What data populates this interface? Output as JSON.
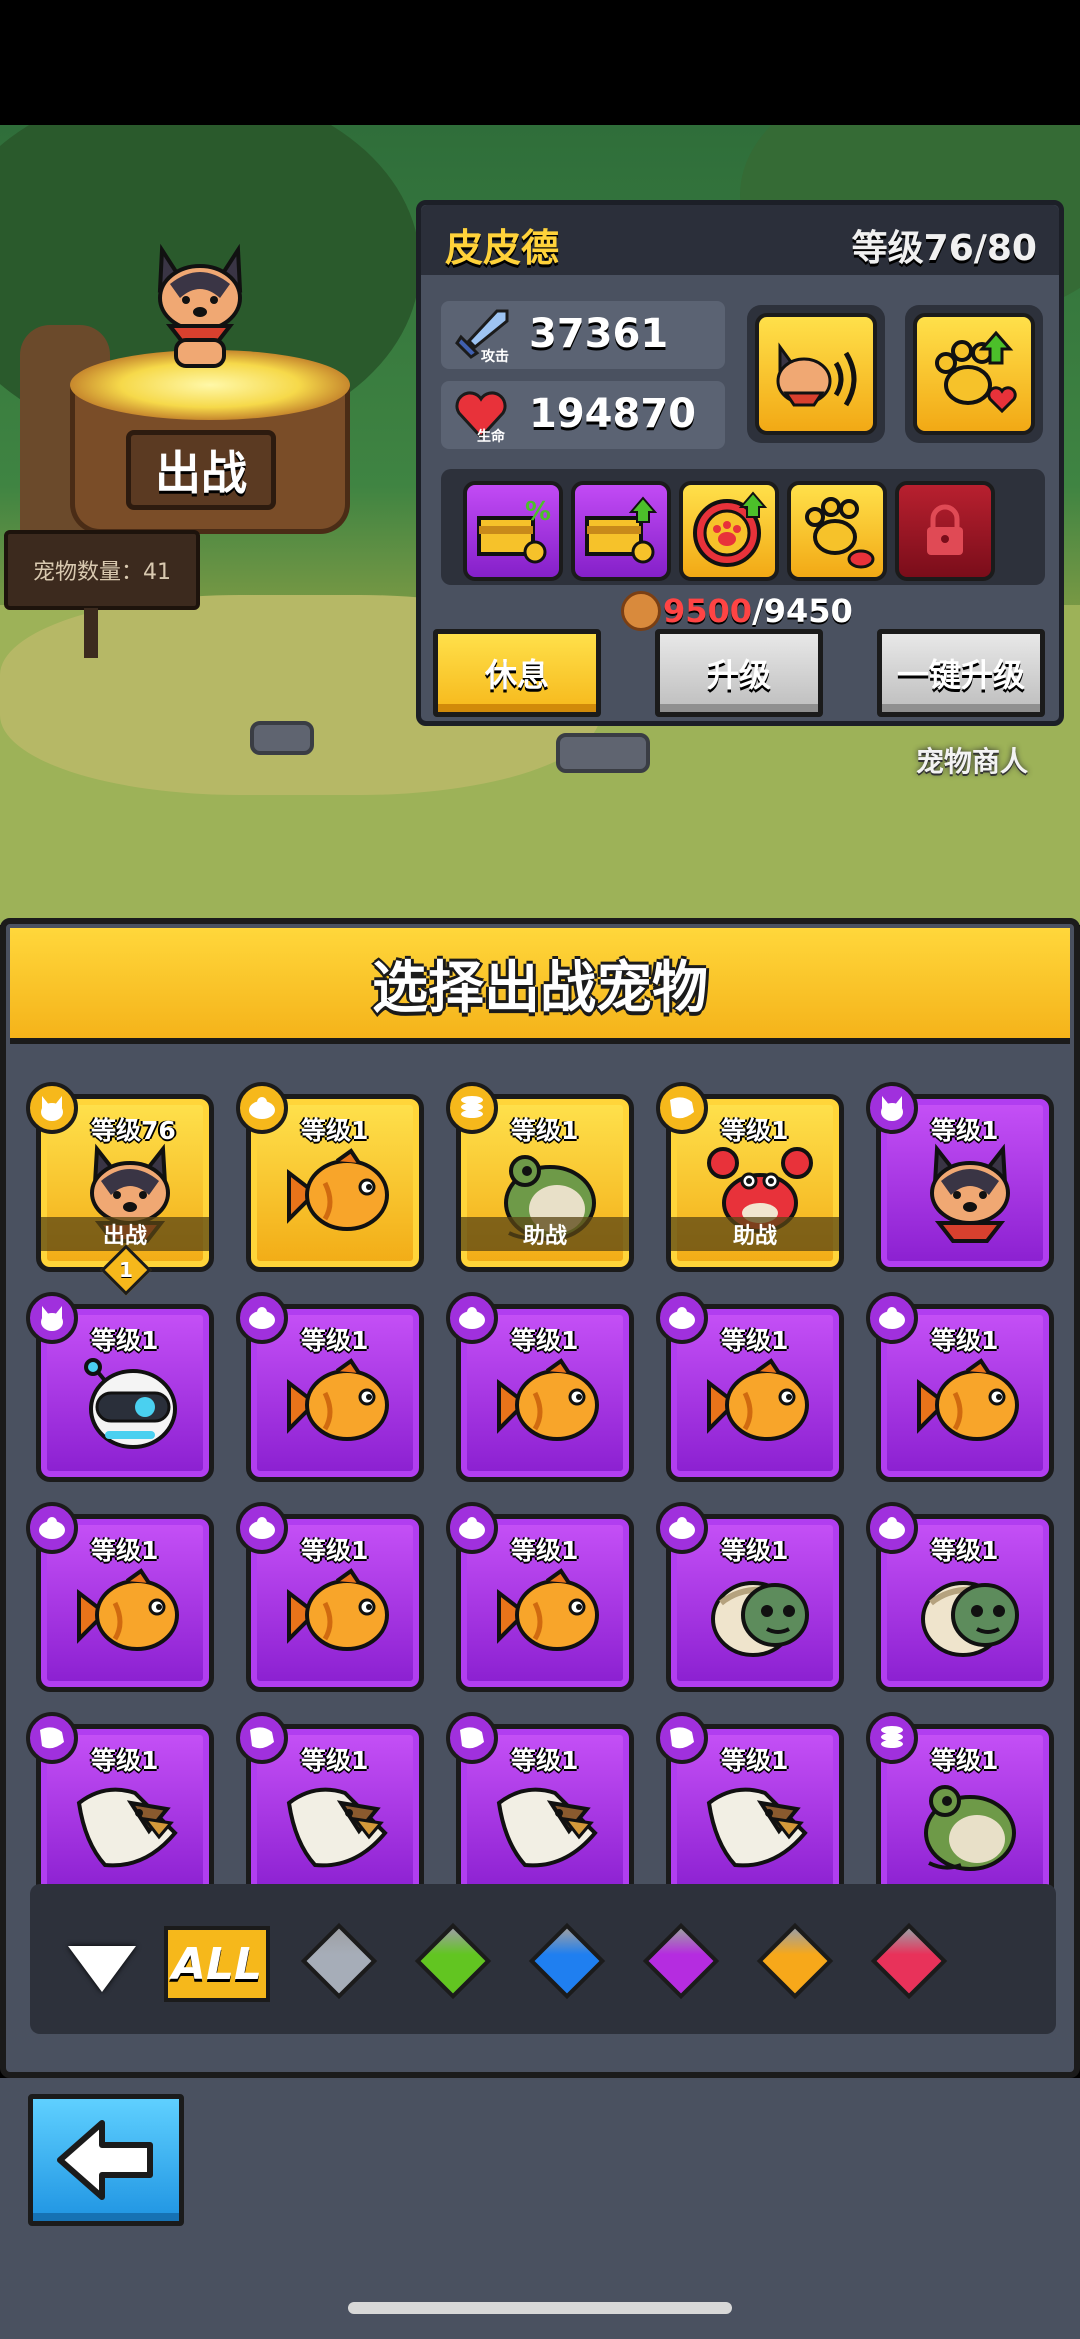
{
  "scene": {
    "sortie_label": "出战",
    "pet_count_label": "宠物数量：41",
    "merchant_label": "宠物商人"
  },
  "stats_panel": {
    "pet_name": "皮皮德",
    "level_text": "等级76/80",
    "attack": {
      "icon_label": "攻击",
      "value": "37361"
    },
    "health": {
      "icon_label": "生命",
      "value": "194870"
    },
    "cost": {
      "have": "9500",
      "need": "/9450"
    },
    "buttons": {
      "rest": "休息",
      "upgrade": "升级",
      "one_click_upgrade": "一键升级"
    }
  },
  "select_panel": {
    "title": "选择出战宠物",
    "pets": [
      {
        "level": "等级76",
        "status": "出战",
        "rarity": "gold",
        "art": "dog-icon",
        "badge": "dog-type-icon"
      },
      {
        "level": "等级1",
        "status": "",
        "rarity": "gold",
        "art": "fish-icon",
        "badge": "turtle-type-icon"
      },
      {
        "level": "等级1",
        "status": "助战",
        "rarity": "gold",
        "art": "frog-icon",
        "badge": "coin-stack-type-icon"
      },
      {
        "level": "等级1",
        "status": "助战",
        "rarity": "gold",
        "art": "crab-icon",
        "badge": "eagle-type-icon"
      },
      {
        "level": "等级1",
        "status": "",
        "rarity": "purple",
        "art": "dog-icon",
        "badge": "dog-type-icon"
      },
      {
        "level": "等级1",
        "status": "",
        "rarity": "purple",
        "art": "robot-icon",
        "badge": "dog-type-icon"
      },
      {
        "level": "等级1",
        "status": "",
        "rarity": "purple",
        "art": "fish-icon",
        "badge": "turtle-type-icon"
      },
      {
        "level": "等级1",
        "status": "",
        "rarity": "purple",
        "art": "fish-icon",
        "badge": "turtle-type-icon"
      },
      {
        "level": "等级1",
        "status": "",
        "rarity": "purple",
        "art": "fish-icon",
        "badge": "turtle-type-icon"
      },
      {
        "level": "等级1",
        "status": "",
        "rarity": "purple",
        "art": "fish-icon",
        "badge": "turtle-type-icon"
      },
      {
        "level": "等级1",
        "status": "",
        "rarity": "purple",
        "art": "fish-icon",
        "badge": "turtle-type-icon"
      },
      {
        "level": "等级1",
        "status": "",
        "rarity": "purple",
        "art": "fish-icon",
        "badge": "turtle-type-icon"
      },
      {
        "level": "等级1",
        "status": "",
        "rarity": "purple",
        "art": "fish-icon",
        "badge": "turtle-type-icon"
      },
      {
        "level": "等级1",
        "status": "",
        "rarity": "purple",
        "art": "turtle-icon",
        "badge": "turtle-type-icon"
      },
      {
        "level": "等级1",
        "status": "",
        "rarity": "purple",
        "art": "turtle-icon",
        "badge": "turtle-type-icon"
      },
      {
        "level": "等级1",
        "status": "",
        "rarity": "purple",
        "art": "eagle-icon",
        "badge": "eagle-type-icon"
      },
      {
        "level": "等级1",
        "status": "",
        "rarity": "purple",
        "art": "eagle-icon",
        "badge": "eagle-type-icon"
      },
      {
        "level": "等级1",
        "status": "",
        "rarity": "purple",
        "art": "eagle-icon",
        "badge": "eagle-type-icon"
      },
      {
        "level": "等级1",
        "status": "",
        "rarity": "purple",
        "art": "eagle-icon",
        "badge": "eagle-type-icon"
      },
      {
        "level": "等级1",
        "status": "",
        "rarity": "purple",
        "art": "frog-icon",
        "badge": "coin-stack-type-icon"
      }
    ],
    "equipped_slot": "1",
    "filter": {
      "all_label": "ALL",
      "gems": [
        {
          "name": "gray-gem",
          "color": "#a6adb8"
        },
        {
          "name": "green-gem",
          "color": "#62c521"
        },
        {
          "name": "blue-gem",
          "color": "#1f7ff0"
        },
        {
          "name": "purple-gem",
          "color": "#b52ce0"
        },
        {
          "name": "orange-gem",
          "color": "#f7a81a"
        },
        {
          "name": "red-gem",
          "color": "#e8325a"
        }
      ]
    }
  },
  "colors": {
    "gold": "#f6b81b",
    "purple": "#a030dd",
    "panel": "#4a5160"
  }
}
